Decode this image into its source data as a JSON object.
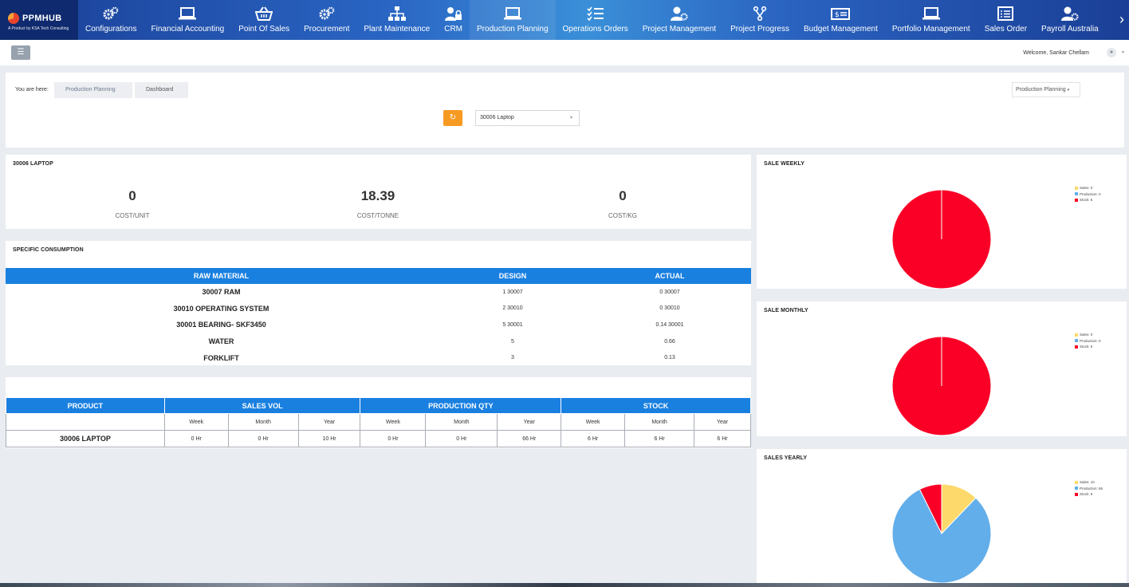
{
  "brand": {
    "name": "PPMHUB",
    "tagline": "A Product by KSA Tech Consulting"
  },
  "nav": [
    {
      "label": "Configurations",
      "icon": "gears-icon"
    },
    {
      "label": "Financial Accounting",
      "icon": "laptop-icon"
    },
    {
      "label": "Point Of Sales",
      "icon": "basket-icon"
    },
    {
      "label": "Procurement",
      "icon": "gears-icon"
    },
    {
      "label": "Plant Maintenance",
      "icon": "org-chart-icon"
    },
    {
      "label": "CRM",
      "icon": "users-lock-icon"
    },
    {
      "label": "Production Planning",
      "icon": "laptop-icon"
    },
    {
      "label": "Operations Orders",
      "icon": "checklist-icon"
    },
    {
      "label": "Project Management",
      "icon": "user-gear-icon"
    },
    {
      "label": "Project Progress",
      "icon": "branch-icon"
    },
    {
      "label": "Budget Management",
      "icon": "money-bill-icon"
    },
    {
      "label": "Portfolio Management",
      "icon": "laptop-icon"
    },
    {
      "label": "Sales Order",
      "icon": "list-icon"
    },
    {
      "label": "Payroll Australia",
      "icon": "user-gear-icon"
    }
  ],
  "header": {
    "welcome": "Welcome, Sankar Chellam"
  },
  "breadcrumb": {
    "prefix": "You are here:",
    "items": [
      "Production Planning",
      "Dashboard"
    ],
    "module_button": "Production Planning"
  },
  "filter": {
    "selected": "30006 Laptop"
  },
  "cost": {
    "title": "30006 LAPTOP",
    "items": [
      {
        "value": "0",
        "label": "COST/UNIT"
      },
      {
        "value": "18.39",
        "label": "COST/TONNE"
      },
      {
        "value": "0",
        "label": "COST/KG"
      }
    ]
  },
  "consumption": {
    "title": "SPECIFIC CONSUMPTION",
    "headers": [
      "RAW MATERIAL",
      "DESIGN",
      "ACTUAL"
    ],
    "rows": [
      [
        "30007 RAM",
        "1 30007",
        "0 30007"
      ],
      [
        "30010 OPERATING SYSTEM",
        "2 30010",
        "0 30010"
      ],
      [
        "30001 BEARING- SKF3450",
        "5 30001",
        "0.14 30001"
      ],
      [
        "WATER",
        "5",
        "0.66"
      ],
      [
        "FORKLIFT",
        "3",
        "0.13"
      ]
    ]
  },
  "product_table": {
    "headers": [
      "PRODUCT",
      "SALES VOL",
      "PRODUCTION QTY",
      "STOCK"
    ],
    "subheaders": [
      "Week",
      "Month",
      "Year"
    ],
    "rows": [
      [
        "30006 LAPTOP",
        "0 Hr",
        "0 Hr",
        "10 Hr",
        "0 Hr",
        "0 Hr",
        "66 Hr",
        "6 Hr",
        "6 Hr",
        "6 Hr"
      ]
    ]
  },
  "colors": {
    "sales": "#fcd96a",
    "production": "#62aeea",
    "stock": "#fa0026",
    "table_header": "#1a80e0",
    "refresh": "#f79a22"
  },
  "chart_data": [
    {
      "type": "pie",
      "title": "SALE WEEKLY",
      "categories": [
        "Sales",
        "Production",
        "Stock"
      ],
      "values": [
        0,
        0,
        6
      ],
      "legend": [
        "Sales: 0",
        "Production: 0",
        "Stock: 6"
      ],
      "legend_position": "top-right"
    },
    {
      "type": "pie",
      "title": "SALE MONTHLY",
      "categories": [
        "Sales",
        "Production",
        "Stock"
      ],
      "values": [
        0,
        0,
        6
      ],
      "legend": [
        "Sales: 0",
        "Production: 0",
        "Stock: 6"
      ],
      "legend_position": "top-right"
    },
    {
      "type": "pie",
      "title": "SALES YEARLY",
      "categories": [
        "Sales",
        "Production",
        "Stock"
      ],
      "values": [
        10,
        66,
        6
      ],
      "legend": [
        "Sales: 10",
        "Production: 66",
        "Stock: 6"
      ],
      "legend_position": "top-right"
    }
  ]
}
